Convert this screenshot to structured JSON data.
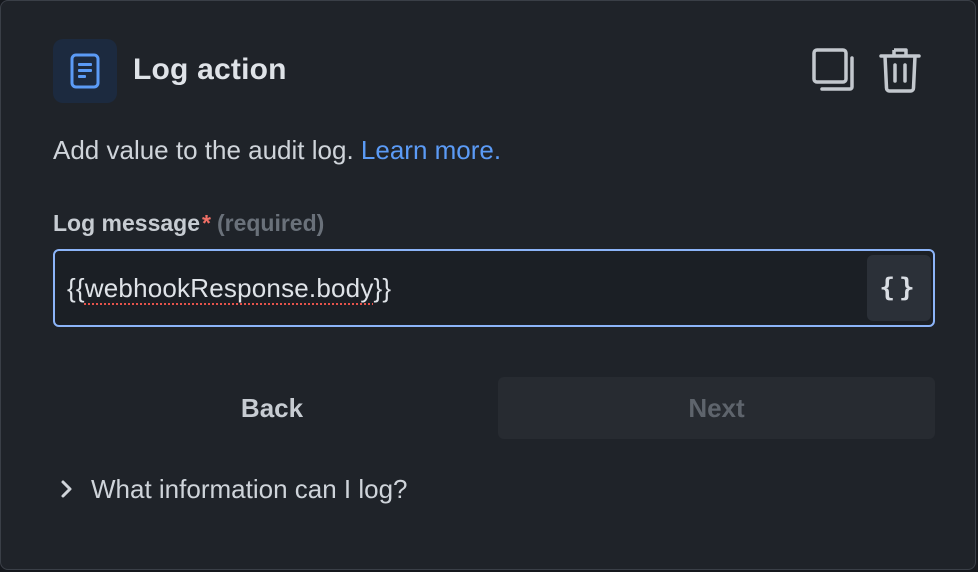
{
  "header": {
    "title": "Log action",
    "icon": "document-icon",
    "actions": [
      {
        "name": "duplicate",
        "icon": "duplicate-icon"
      },
      {
        "name": "delete",
        "icon": "trash-icon"
      }
    ]
  },
  "description": {
    "text": "Add value to the audit log.",
    "link_text": "Learn more."
  },
  "field": {
    "label": "Log message",
    "asterisk": "*",
    "required_note": "(required)",
    "value_open": "{{",
    "value_word": "webhookResponse.body",
    "value_close": "}}",
    "insert_variable_label": "{}"
  },
  "buttons": {
    "back": "Back",
    "next": "Next"
  },
  "disclosure": {
    "label": "What information can I log?"
  },
  "colors": {
    "background": "#1f2329",
    "accent": "#5b9bf6",
    "focus_border": "#8cb4f8",
    "required": "#f06f66",
    "icon_tile": "#1c2a3f"
  }
}
